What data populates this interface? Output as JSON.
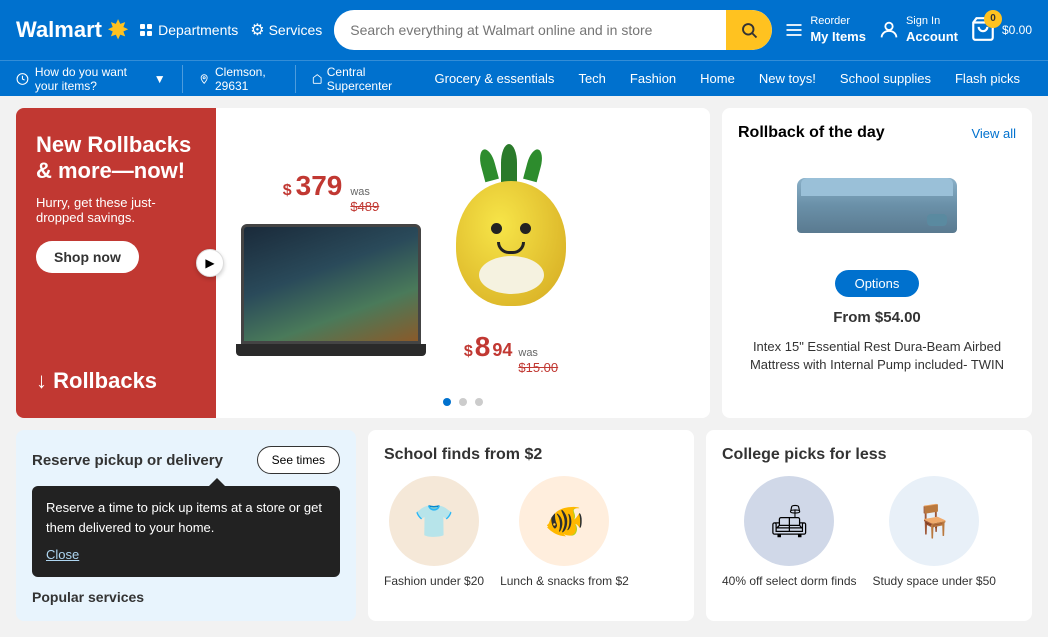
{
  "header": {
    "logo_text": "Walmart",
    "spark_icon": "✸",
    "departments_label": "Departments",
    "services_label": "Services",
    "search_placeholder": "Search everything at Walmart online and in store",
    "reorder_label": "Reorder",
    "reorder_sub": "My Items",
    "account_label": "Sign In",
    "account_sub": "Account",
    "cart_count": "0",
    "cart_price": "$0.00"
  },
  "subheader": {
    "delivery_label": "How do you want your items?",
    "location_label": "Clemson, 29631",
    "store_label": "Central Supercenter",
    "nav_items": [
      {
        "label": "Grocery & essentials",
        "key": "grocery"
      },
      {
        "label": "Tech",
        "key": "tech"
      },
      {
        "label": "Fashion",
        "key": "fashion"
      },
      {
        "label": "Home",
        "key": "home"
      },
      {
        "label": "New toys!",
        "key": "toys"
      },
      {
        "label": "School supplies",
        "key": "school"
      },
      {
        "label": "Flash picks",
        "key": "flash"
      }
    ]
  },
  "hero": {
    "heading_line1": "New Rollbacks",
    "heading_line2": "& more—now!",
    "subtext": "Hurry, get these just-dropped savings.",
    "cta_label": "Shop now",
    "rollbacks_label": "↓ Rollbacks",
    "laptop_price_main": "379",
    "laptop_price_dollar": "$",
    "laptop_was_label": "was",
    "laptop_was_price": "$489",
    "squishmallow_price_dollar": "$",
    "squishmallow_price_main": "8",
    "squishmallow_price_cents": "94",
    "squishmallow_was_label": "was",
    "squishmallow_was_price": "$15.00"
  },
  "rollback_day": {
    "title": "Rollback of the day",
    "view_all": "View all",
    "options_btn": "Options",
    "from_price": "From $54.00",
    "product_name": "Intex 15\" Essential Rest Dura-Beam Airbed Mattress with Internal Pump included- TWIN"
  },
  "bottom": {
    "pickup_title": "Reserve pickup or delivery",
    "see_times_btn": "See times",
    "tooltip_text": "Reserve a time to pick up items at a store or get them delivered to your home.",
    "tooltip_close": "Close",
    "popular_services": "Popular services",
    "school_finds_title": "School finds from $2",
    "school_items": [
      {
        "label": "Fashion under $20",
        "emoji": "👕"
      },
      {
        "label": "Lunch & snacks from $2",
        "emoji": "🐠"
      }
    ],
    "college_picks_title": "College picks for less",
    "college_items": [
      {
        "label": "40% off select dorm finds",
        "emoji": "🛋"
      },
      {
        "label": "Study space under $50",
        "emoji": "🪑"
      }
    ]
  }
}
